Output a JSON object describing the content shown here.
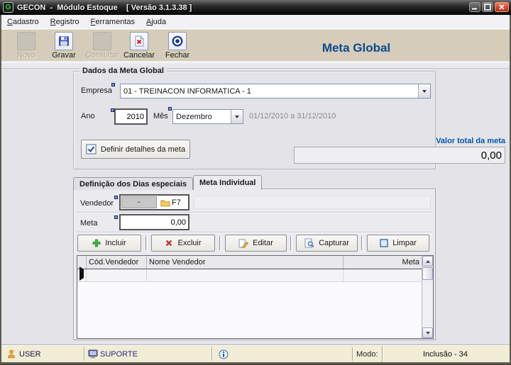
{
  "window": {
    "title": "GECON  -  Módulo Estoque    [ Versão 3.1.3.38 ]",
    "icon_letter": "G"
  },
  "menu": {
    "items": [
      "Cadastro",
      "Registro",
      "Ferramentas",
      "Ajuda"
    ]
  },
  "toolbar": {
    "buttons": [
      {
        "label": "Novo",
        "state": "disabled"
      },
      {
        "label": "Gravar",
        "state": "enabled"
      },
      {
        "label": "Consultar",
        "state": "disabled"
      },
      {
        "label": "Cancelar",
        "state": "enabled"
      },
      {
        "label": "Fechar",
        "state": "enabled"
      }
    ],
    "screen_title": "Meta Global"
  },
  "dados_meta_global": {
    "group_title": "Dados da Meta Global",
    "empresa": {
      "label": "Empresa",
      "value": "01 - TREINACON INFORMATICA - 1"
    },
    "ano": {
      "label": "Ano",
      "value": "2010"
    },
    "mes": {
      "label": "Mês",
      "value": "Dezembro"
    },
    "periodo": "01/12/2010 a 31/12/2010",
    "definir_button_label": "Definir detalhes da meta",
    "valor_total": {
      "label": "Valor total da meta",
      "value": "0,00"
    }
  },
  "tabs": [
    {
      "label": "Definição dos Dias especiais",
      "active": false
    },
    {
      "label": "Meta Individual",
      "active": true
    }
  ],
  "meta_individual": {
    "vendedor": {
      "label": "Vendedor",
      "value": "-",
      "shortcut": "F7"
    },
    "meta": {
      "label": "Meta",
      "value": "0,00"
    },
    "actions": [
      "Incluir",
      "Excluir",
      "Editar",
      "Capturar",
      "Limpar"
    ],
    "table": {
      "columns": [
        "Cód.Vendedor",
        "Nome Vendedor",
        "Meta"
      ],
      "rows": []
    }
  },
  "status_bar": {
    "user": "USER",
    "suporte": "SUPORTE",
    "modo_label": "Modo:",
    "modo_value": "Inclusão - 34"
  },
  "colors": {
    "toolbar_bg": "#d5cdb9",
    "screen_title_text": "#0a4a8f",
    "valor_total_label_text": "#0057ad",
    "status_bar_bg": "#f1edd6",
    "close_button": "#cf4428",
    "suporte_text": "#2b2b85",
    "main_bg": "#e4e3e8"
  }
}
